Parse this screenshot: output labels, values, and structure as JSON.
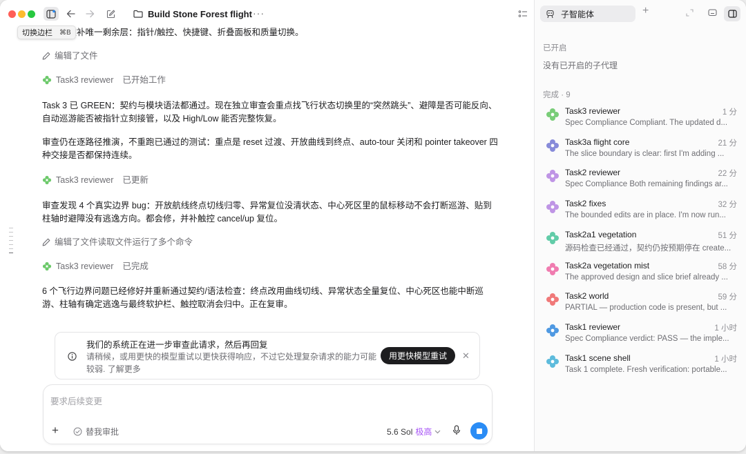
{
  "toolbar": {
    "title": "Build Stone Forest flight",
    "tooltip_label": "切换边栏",
    "tooltip_shortcut": "⌘B"
  },
  "conversation": {
    "top_line": "入。现在补唯一剩余层：指针/触控、快捷键、折叠面板和质量切换。",
    "action1": "编辑了文件",
    "agent1_name": "Task3 reviewer",
    "agent1_status": "已开始工作",
    "para1": "Task 3 已 GREEN：契约与模块语法都通过。现在独立审查会重点找飞行状态切换里的“突然跳头”、避障是否可能反向、自动巡游能否被指针立刻接管，以及 High/Low 能否完整恢复。",
    "para2": "审查仍在逐路径推演，不重跑已通过的测试：重点是 reset 过渡、开放曲线到终点、auto-tour 关闭和 pointer takeover 四种交接是否都保持连续。",
    "agent2_name": "Task3 reviewer",
    "agent2_status": "已更新",
    "para3": "审查发现 4 个真实边界 bug：开放航线终点切线归零、异常复位没清状态、中心死区里的鼠标移动不会打断巡游、贴到柱轴时避障没有逃逸方向。都会修，并补触控 cancel/up 复位。",
    "action2": "编辑了文件读取文件运行了多个命令",
    "agent3_name": "Task3 reviewer",
    "agent3_status": "已完成",
    "para4": "6 个飞行边界问题已经修好并重新通过契约/语法检查：终点改用曲线切线、异常状态全量复位、中心死区也能中断巡游、柱轴有确定逃逸与最终软护栏、触控取消会归中。正在复审。"
  },
  "notice": {
    "title": "我们的系统正在进一步审查此请求，然后再回复",
    "body": "请稍候，或用更快的模型重试以更快获得响应，不过它处理复杂请求的能力可能较弱.",
    "learn_more": "了解更多",
    "button": "用更快模型重试"
  },
  "composer": {
    "placeholder": "要求后续变更",
    "approve_label": "替我审批",
    "model": "5.6 Sol",
    "level": "极高"
  },
  "panel": {
    "tab_label": "子智能体",
    "open_label": "已开启",
    "open_empty": "没有已开启的子代理",
    "done_label": "完成 · 9",
    "agents": [
      {
        "name": "Task3 reviewer",
        "time": "1 分",
        "desc": "Spec Compliance Compliant. The updated d...",
        "color": "#6cc96a"
      },
      {
        "name": "Task3a flight core",
        "time": "21 分",
        "desc": "The slice boundary is clear: first I'm adding ...",
        "color": "#7b7fd6"
      },
      {
        "name": "Task2 reviewer",
        "time": "22 分",
        "desc": "Spec Compliance Both remaining findings ar...",
        "color": "#b98be3"
      },
      {
        "name": "Task2 fixes",
        "time": "32 分",
        "desc": "The bounded edits are in place. I'm now run...",
        "color": "#b98be3"
      },
      {
        "name": "Task2a1 vegetation",
        "time": "51 分",
        "desc": "源码检查已经通过，契约仍按预期停在 create...",
        "color": "#52c8a0"
      },
      {
        "name": "Task2a vegetation mist",
        "time": "58 分",
        "desc": "The approved design and slice brief already ...",
        "color": "#ef6fa8"
      },
      {
        "name": "Task2 world",
        "time": "59 分",
        "desc": "PARTIAL — production code is present, but ...",
        "color": "#ef6b6b"
      },
      {
        "name": "Task1 reviewer",
        "time": "1 小时",
        "desc": "Spec Compliance verdict: PASS — the imple...",
        "color": "#3d8fe0"
      },
      {
        "name": "Task1 scene shell",
        "time": "1 小时",
        "desc": "Task 1 complete. Fresh verification: portable...",
        "color": "#4cb5d9"
      }
    ]
  }
}
